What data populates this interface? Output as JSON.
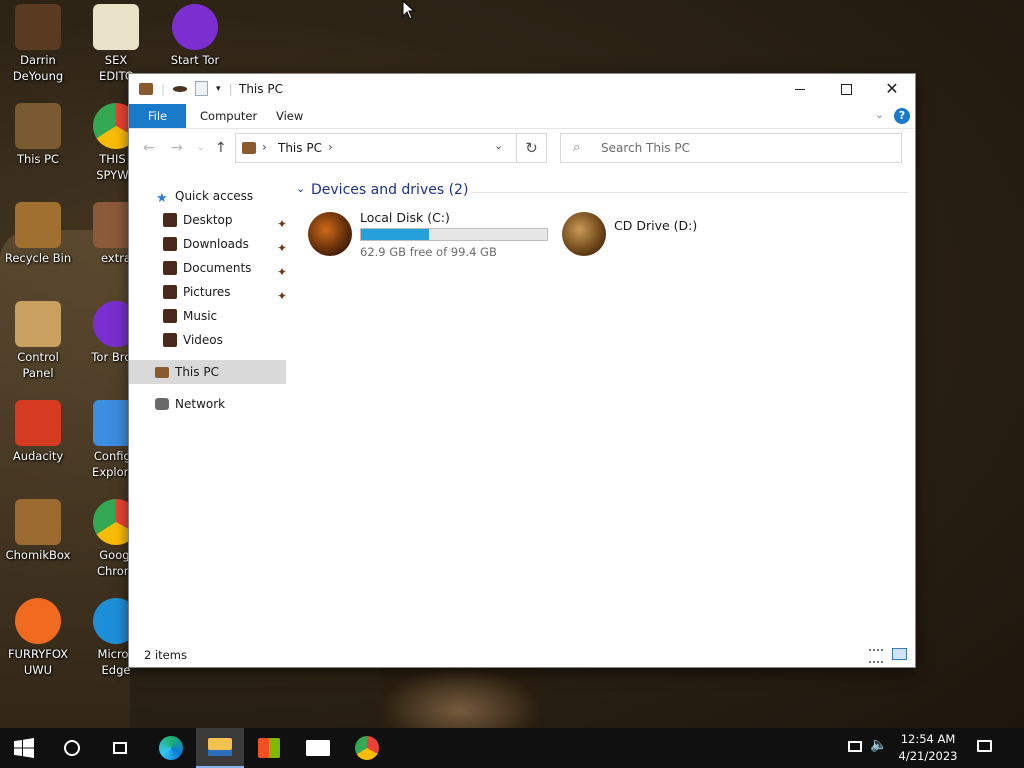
{
  "desktop": {
    "icons": [
      {
        "label_1": "Darrin",
        "label_2": "DeYoung",
        "icon": "person-figure-icon"
      },
      {
        "label_1": "SEX",
        "label_2": "EDITC",
        "icon": "hxd-editor-icon"
      },
      {
        "label_1": "Start Tor",
        "label_2": "",
        "icon": "tor-icon"
      },
      {
        "label_1": "This PC",
        "label_2": "",
        "icon": "this-pc-icon"
      },
      {
        "label_1": "THIS I",
        "label_2": "SPYWA",
        "icon": "chrome-icon"
      },
      {
        "label_1": "Recycle Bin",
        "label_2": "",
        "icon": "recycle-bin-icon"
      },
      {
        "label_1": "extra",
        "label_2": "",
        "icon": "archive-icon"
      },
      {
        "label_1": "Control Panel",
        "label_2": "",
        "icon": "control-panel-icon"
      },
      {
        "label_1": "Tor Brow",
        "label_2": "",
        "icon": "tor-browser-icon"
      },
      {
        "label_1": "Audacity",
        "label_2": "",
        "icon": "audacity-icon"
      },
      {
        "label_1": "Configu",
        "label_2": "Explorer",
        "icon": "shield-icon"
      },
      {
        "label_1": "ChomikBox",
        "label_2": "",
        "icon": "chomikbox-icon"
      },
      {
        "label_1": "Googl",
        "label_2": "Chrom",
        "icon": "chrome-icon"
      },
      {
        "label_1": "FURRYFOX",
        "label_2": "UWU",
        "icon": "firefox-icon"
      },
      {
        "label_1": "Micros",
        "label_2": "Edge",
        "icon": "edge-icon"
      }
    ]
  },
  "window": {
    "title": "This PC",
    "ribbon_tabs": [
      "File",
      "Computer",
      "View"
    ],
    "address_path": "This PC",
    "search_placeholder": "Search This PC",
    "nav": {
      "quick_access": "Quick access",
      "quick_items": [
        "Desktop",
        "Downloads",
        "Documents",
        "Pictures",
        "Music",
        "Videos"
      ],
      "this_pc": "This PC",
      "network": "Network"
    },
    "group_header": "Devices and drives (2)",
    "drives": [
      {
        "name": "Local Disk (C:)",
        "free_text": "62.9 GB free of 99.4 GB",
        "used_fraction": 0.367
      },
      {
        "name": "CD Drive (D:)"
      }
    ],
    "status": "2 items"
  },
  "taskbar": {
    "items": [
      "start",
      "search",
      "task-view",
      "edge",
      "file-explorer",
      "store",
      "mail",
      "chrome"
    ],
    "time": "12:54 AM",
    "date": "4/21/2023"
  },
  "colors": {
    "accent": "#1979ca",
    "drive_bar": "#26a0da",
    "group_header": "#1e3287"
  }
}
